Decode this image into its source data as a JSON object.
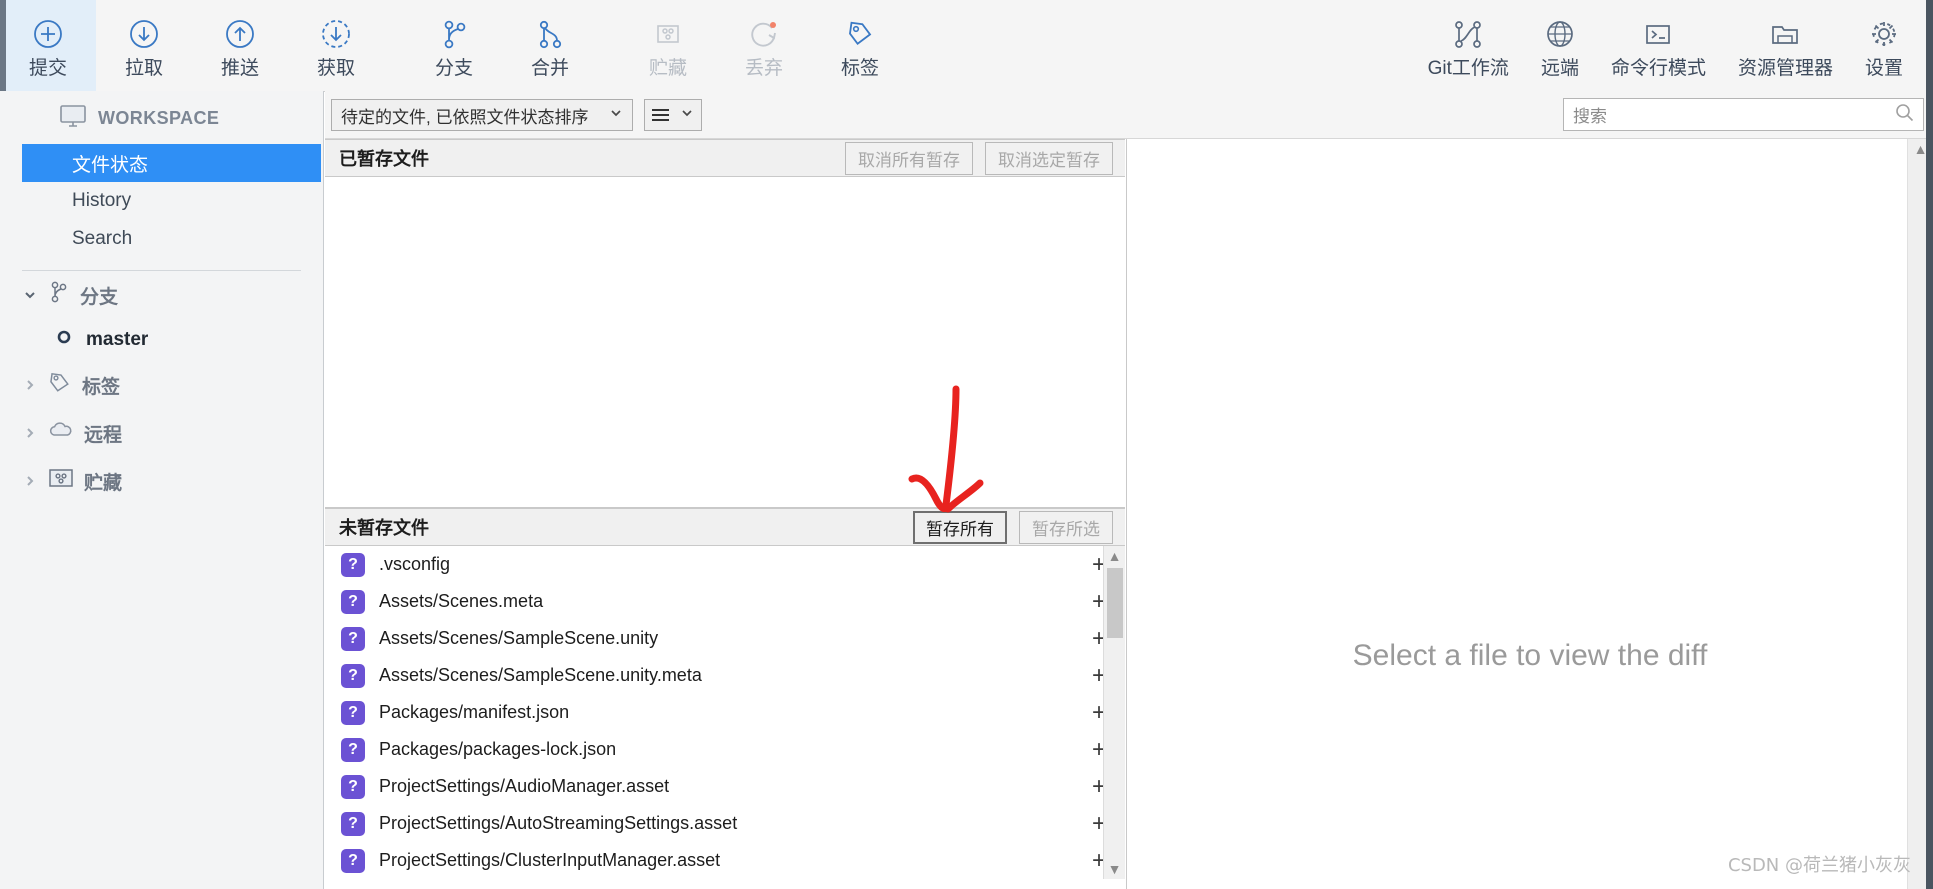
{
  "toolbar": {
    "left_buttons": [
      {
        "label": "提交",
        "icon": "commit-plus-circle-icon",
        "state": "active"
      },
      {
        "label": "拉取",
        "icon": "pull-down-arrow-circle-icon",
        "state": "normal"
      },
      {
        "label": "推送",
        "icon": "push-up-arrow-circle-icon",
        "state": "normal"
      },
      {
        "label": "获取",
        "icon": "fetch-dashed-circle-icon",
        "state": "normal"
      },
      {
        "label": "分支",
        "icon": "branch-icon",
        "state": "normal"
      },
      {
        "label": "合并",
        "icon": "merge-icon",
        "state": "normal"
      },
      {
        "label": "贮藏",
        "icon": "stash-box-icon",
        "state": "disabled"
      },
      {
        "label": "丢弃",
        "icon": "discard-reset-icon",
        "state": "disabled"
      },
      {
        "label": "标签",
        "icon": "tag-icon",
        "state": "normal"
      }
    ],
    "right_buttons": [
      {
        "label": "Git工作流",
        "icon": "gitflow-icon",
        "state": "normal"
      },
      {
        "label": "远端",
        "icon": "globe-icon",
        "state": "normal"
      },
      {
        "label": "命令行模式",
        "icon": "terminal-icon",
        "state": "normal"
      },
      {
        "label": "资源管理器",
        "icon": "folder-explorer-icon",
        "state": "normal"
      },
      {
        "label": "设置",
        "icon": "gear-icon",
        "state": "normal"
      }
    ]
  },
  "sidebar": {
    "workspace_label": "WORKSPACE",
    "workspace_icon": "monitor-icon",
    "items": [
      {
        "label": "文件状态",
        "selected": true
      },
      {
        "label": "History",
        "selected": false
      },
      {
        "label": "Search",
        "selected": false
      }
    ],
    "groups": [
      {
        "label": "分支",
        "icon": "branch-icon",
        "expanded": true,
        "chevron": "chevron-down"
      },
      {
        "label": "标签",
        "icon": "tag-icon",
        "expanded": false,
        "chevron": "chevron-right"
      },
      {
        "label": "远程",
        "icon": "cloud-icon",
        "expanded": false,
        "chevron": "chevron-right"
      },
      {
        "label": "贮藏",
        "icon": "stash-box-icon",
        "expanded": false,
        "chevron": "chevron-right"
      }
    ],
    "branches": [
      {
        "label": "master",
        "icon": "branch-dot-icon",
        "current": true
      }
    ]
  },
  "filterbar": {
    "filter_value": "待定的文件, 已依照文件状态排序",
    "filter_chevron": "chevron-down-icon",
    "view_icon": "list-view-icon",
    "view_chevron": "chevron-down-icon"
  },
  "search": {
    "placeholder": "搜索",
    "value": "",
    "icon": "search-icon"
  },
  "staged": {
    "title": "已暂存文件",
    "unstage_all_label": "取消所有暂存",
    "unstage_selected_label": "取消选定暂存",
    "files": []
  },
  "unstaged": {
    "title": "未暂存文件",
    "stage_all_label": "暂存所有",
    "stage_selected_label": "暂存所选",
    "files": [
      {
        "status": "?",
        "name": ".vsconfig",
        "action": "+"
      },
      {
        "status": "?",
        "name": "Assets/Scenes.meta",
        "action": "+"
      },
      {
        "status": "?",
        "name": "Assets/Scenes/SampleScene.unity",
        "action": "+"
      },
      {
        "status": "?",
        "name": "Assets/Scenes/SampleScene.unity.meta",
        "action": "+"
      },
      {
        "status": "?",
        "name": "Packages/manifest.json",
        "action": "+"
      },
      {
        "status": "?",
        "name": "Packages/packages-lock.json",
        "action": "+"
      },
      {
        "status": "?",
        "name": "ProjectSettings/AudioManager.asset",
        "action": "+"
      },
      {
        "status": "?",
        "name": "ProjectSettings/AutoStreamingSettings.asset",
        "action": "+"
      },
      {
        "status": "?",
        "name": "ProjectSettings/ClusterInputManager.asset",
        "action": "+"
      }
    ]
  },
  "diff": {
    "empty_message": "Select a file to view the diff"
  },
  "annotation": {
    "arrow_color": "#e8231f",
    "points_to": "暂存所有"
  },
  "watermark": {
    "text": "CSDN @荷兰猪小灰灰"
  },
  "colors": {
    "accent": "#2f8ff5",
    "icon_blue": "#4a6fa5",
    "status_badge": "#6b52d4",
    "toolbar_bg": "#f5f5f5",
    "sidebar_bg": "#f3f4f5"
  }
}
